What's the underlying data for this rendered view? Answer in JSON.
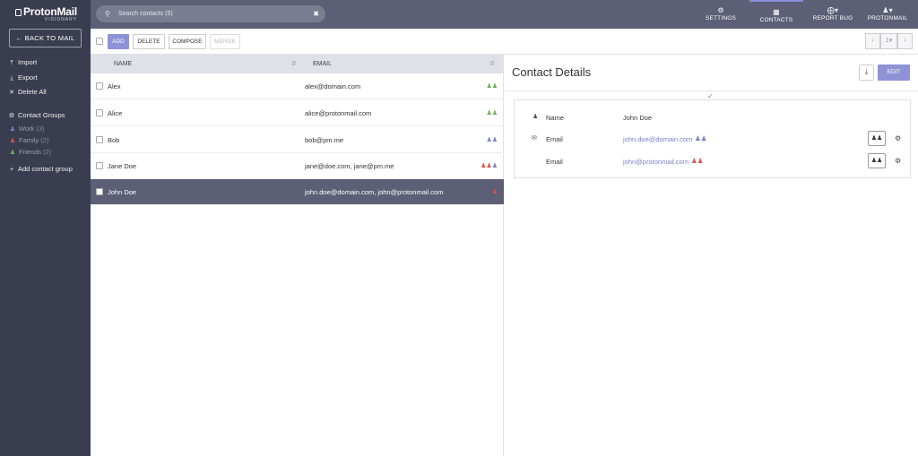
{
  "app": {
    "brand": "ProtonMail",
    "brand_sub": "VISIONARY"
  },
  "sidebar": {
    "back_label": "BACK TO MAIL",
    "actions": [
      {
        "label": "Import",
        "icon": "upload-icon"
      },
      {
        "label": "Export",
        "icon": "download-icon"
      },
      {
        "label": "Delete All",
        "icon": "close-icon"
      }
    ],
    "groups_title": "Contact Groups",
    "groups": [
      {
        "name": "Work",
        "count": "(3)",
        "color": "#7b7fc9"
      },
      {
        "name": "Family",
        "count": "(2)",
        "color": "#d9534f"
      },
      {
        "name": "Friends",
        "count": "(2)",
        "color": "#6aaf55"
      }
    ],
    "add_group_label": "Add contact group"
  },
  "topbar": {
    "search_placeholder": "Search contacts (5)",
    "nav": [
      {
        "label": "SETTINGS",
        "icon": "gears-icon"
      },
      {
        "label": "CONTACTS",
        "icon": "address-book-icon",
        "active": true
      },
      {
        "label": "REPORT BUG",
        "icon": "bug-icon"
      },
      {
        "label": "PROTONMAIL",
        "icon": "user-icon"
      }
    ]
  },
  "toolbar": {
    "add": "ADD",
    "delete": "DELETE",
    "compose": "COMPOSE",
    "merge": "MERGE",
    "page": "1"
  },
  "list": {
    "columns": {
      "name": "NAME",
      "email": "EMAIL"
    },
    "rows": [
      {
        "name": "Alex",
        "email": "alex@domain.com",
        "groups": [
          "green"
        ]
      },
      {
        "name": "Alice",
        "email": "alice@protonmail.com",
        "groups": [
          "green"
        ]
      },
      {
        "name": "Bob",
        "email": "bob@pm.me",
        "groups": [
          "purple"
        ]
      },
      {
        "name": "Jane Doe",
        "email": "jane@doe.com, jane@pm.me",
        "groups": [
          "red",
          "purple"
        ]
      },
      {
        "name": "John Doe",
        "email": "john.doe@domain.com, john@protonmail.com",
        "groups": [
          "red"
        ],
        "selected": true
      }
    ]
  },
  "detail": {
    "title": "Contact Details",
    "edit_label": "EDIT",
    "fields": [
      {
        "label": "Name",
        "value": "John Doe"
      },
      {
        "label": "Email",
        "value": "john.doe@domain.com",
        "group_color": "purple"
      },
      {
        "label": "Email",
        "value": "john@protonmail.com",
        "group_color": "red"
      }
    ]
  },
  "colors": {
    "accent": "#8f92d6",
    "sidebar": "#3a3d4f",
    "topbar": "#5c5f76"
  }
}
